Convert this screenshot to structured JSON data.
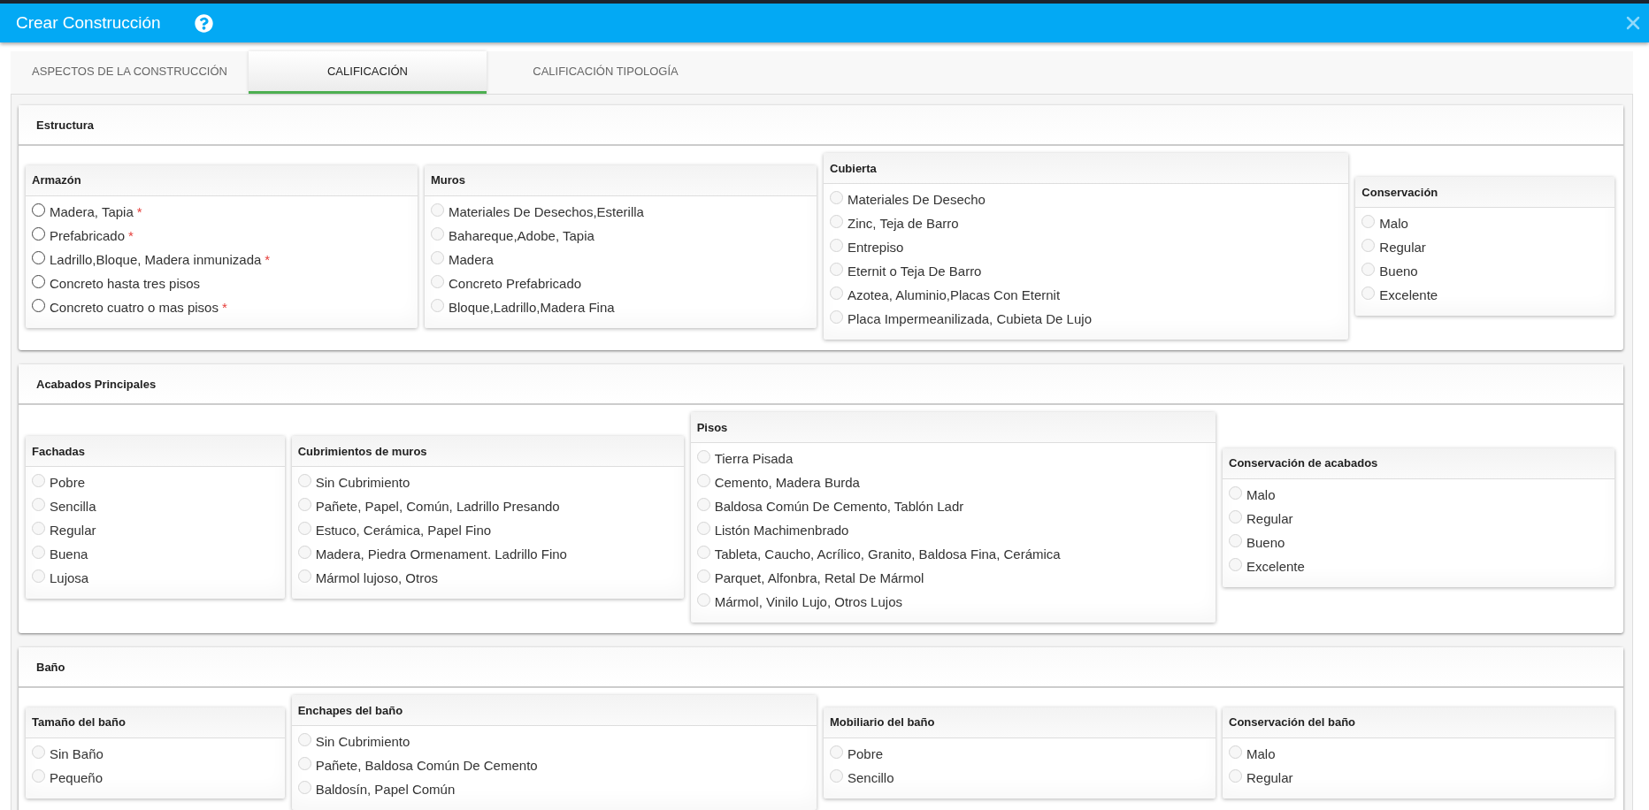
{
  "window": {
    "title": "Crear Construcción"
  },
  "tabs": [
    {
      "label": "ASPECTOS DE LA CONSTRUCCIÓN",
      "selected": false
    },
    {
      "label": "CALIFICACIÓN",
      "selected": true
    },
    {
      "label": "CALIFICACIÓN TIPOLOGÍA",
      "selected": false
    }
  ],
  "sections": [
    {
      "title": "Estructura",
      "groups": [
        {
          "title": "Armazón",
          "disabled": false,
          "options": [
            {
              "label": "Madera, Tapia",
              "mark": "*",
              "selected": false
            },
            {
              "label": "Prefabricado",
              "mark": "*",
              "selected": false
            },
            {
              "label": "Ladrillo,Bloque, Madera inmunizada",
              "mark": "*",
              "selected": false
            },
            {
              "label": "Concreto hasta tres pisos",
              "selected": false
            },
            {
              "label": "Concreto cuatro o mas pisos",
              "mark": "*",
              "selected": false
            }
          ]
        },
        {
          "title": "Muros",
          "disabled": true,
          "options": [
            {
              "label": "Materiales De Desechos,Esterilla",
              "selected": false
            },
            {
              "label": "Bahareque,Adobe, Tapia",
              "selected": false
            },
            {
              "label": "Madera",
              "selected": false
            },
            {
              "label": "Concreto Prefabricado",
              "selected": false
            },
            {
              "label": "Bloque,Ladrillo,Madera Fina",
              "selected": false
            }
          ]
        },
        {
          "title": "Cubierta",
          "disabled": true,
          "options": [
            {
              "label": "Materiales De Desecho",
              "selected": false
            },
            {
              "label": "Zinc, Teja de Barro",
              "selected": false
            },
            {
              "label": "Entrepiso",
              "selected": false
            },
            {
              "label": "Eternit o Teja De Barro",
              "selected": false
            },
            {
              "label": "Azotea, Aluminio,Placas Con Eternit",
              "selected": false
            },
            {
              "label": "Placa Impermeanilizada, Cubieta De Lujo",
              "selected": false
            }
          ]
        },
        {
          "title": "Conservación",
          "disabled": true,
          "options": [
            {
              "label": "Malo",
              "selected": false
            },
            {
              "label": "Regular",
              "selected": false
            },
            {
              "label": "Bueno",
              "selected": false
            },
            {
              "label": "Excelente",
              "selected": false
            }
          ]
        }
      ]
    },
    {
      "title": "Acabados Principales",
      "groups": [
        {
          "title": "Fachadas",
          "disabled": true,
          "options": [
            {
              "label": "Pobre",
              "selected": false
            },
            {
              "label": "Sencilla",
              "selected": false
            },
            {
              "label": "Regular",
              "selected": false
            },
            {
              "label": "Buena",
              "selected": false
            },
            {
              "label": "Lujosa",
              "selected": false
            }
          ]
        },
        {
          "title": "Cubrimientos de muros",
          "disabled": true,
          "options": [
            {
              "label": "Sin Cubrimiento",
              "selected": false
            },
            {
              "label": "Pañete, Papel, Común, Ladrillo Presando",
              "selected": false
            },
            {
              "label": "Estuco, Cerámica, Papel Fino",
              "selected": false
            },
            {
              "label": "Madera, Piedra Ormenament. Ladrillo Fino",
              "selected": false
            },
            {
              "label": "Mármol lujoso, Otros",
              "selected": false
            }
          ]
        },
        {
          "title": "Pisos",
          "disabled": true,
          "options": [
            {
              "label": "Tierra Pisada",
              "selected": false
            },
            {
              "label": "Cemento, Madera Burda",
              "selected": false
            },
            {
              "label": "Baldosa Común De Cemento, Tablón Ladr",
              "selected": false
            },
            {
              "label": "Listón Machimenbrado",
              "selected": false
            },
            {
              "label": "Tableta, Caucho, Acrílico, Granito, Baldosa Fina, Cerámica",
              "selected": false
            },
            {
              "label": "Parquet, Alfonbra, Retal De Mármol",
              "selected": false
            },
            {
              "label": "Mármol, Vinilo Lujo, Otros Lujos",
              "selected": false
            }
          ]
        },
        {
          "title": "Conservación de acabados",
          "disabled": true,
          "options": [
            {
              "label": "Malo",
              "selected": false
            },
            {
              "label": "Regular",
              "selected": false
            },
            {
              "label": "Bueno",
              "selected": false
            },
            {
              "label": "Excelente",
              "selected": false
            }
          ]
        }
      ]
    },
    {
      "title": "Baño",
      "groups": [
        {
          "title": "Tamaño del baño",
          "disabled": true,
          "options": [
            {
              "label": "Sin Baño",
              "selected": false
            },
            {
              "label": "Pequeño",
              "selected": false
            }
          ]
        },
        {
          "title": "Enchapes del baño",
          "disabled": true,
          "options": [
            {
              "label": "Sin Cubrimiento",
              "selected": false
            },
            {
              "label": "Pañete, Baldosa Común De Cemento",
              "selected": false
            },
            {
              "label": "Baldosín, Papel Común",
              "selected": false
            }
          ]
        },
        {
          "title": "Mobiliario del baño",
          "disabled": true,
          "options": [
            {
              "label": "Pobre",
              "selected": false
            },
            {
              "label": "Sencillo",
              "selected": false
            }
          ]
        },
        {
          "title": "Conservación del baño",
          "disabled": true,
          "options": [
            {
              "label": "Malo",
              "selected": false
            },
            {
              "label": "Regular",
              "selected": false
            }
          ]
        }
      ]
    }
  ]
}
